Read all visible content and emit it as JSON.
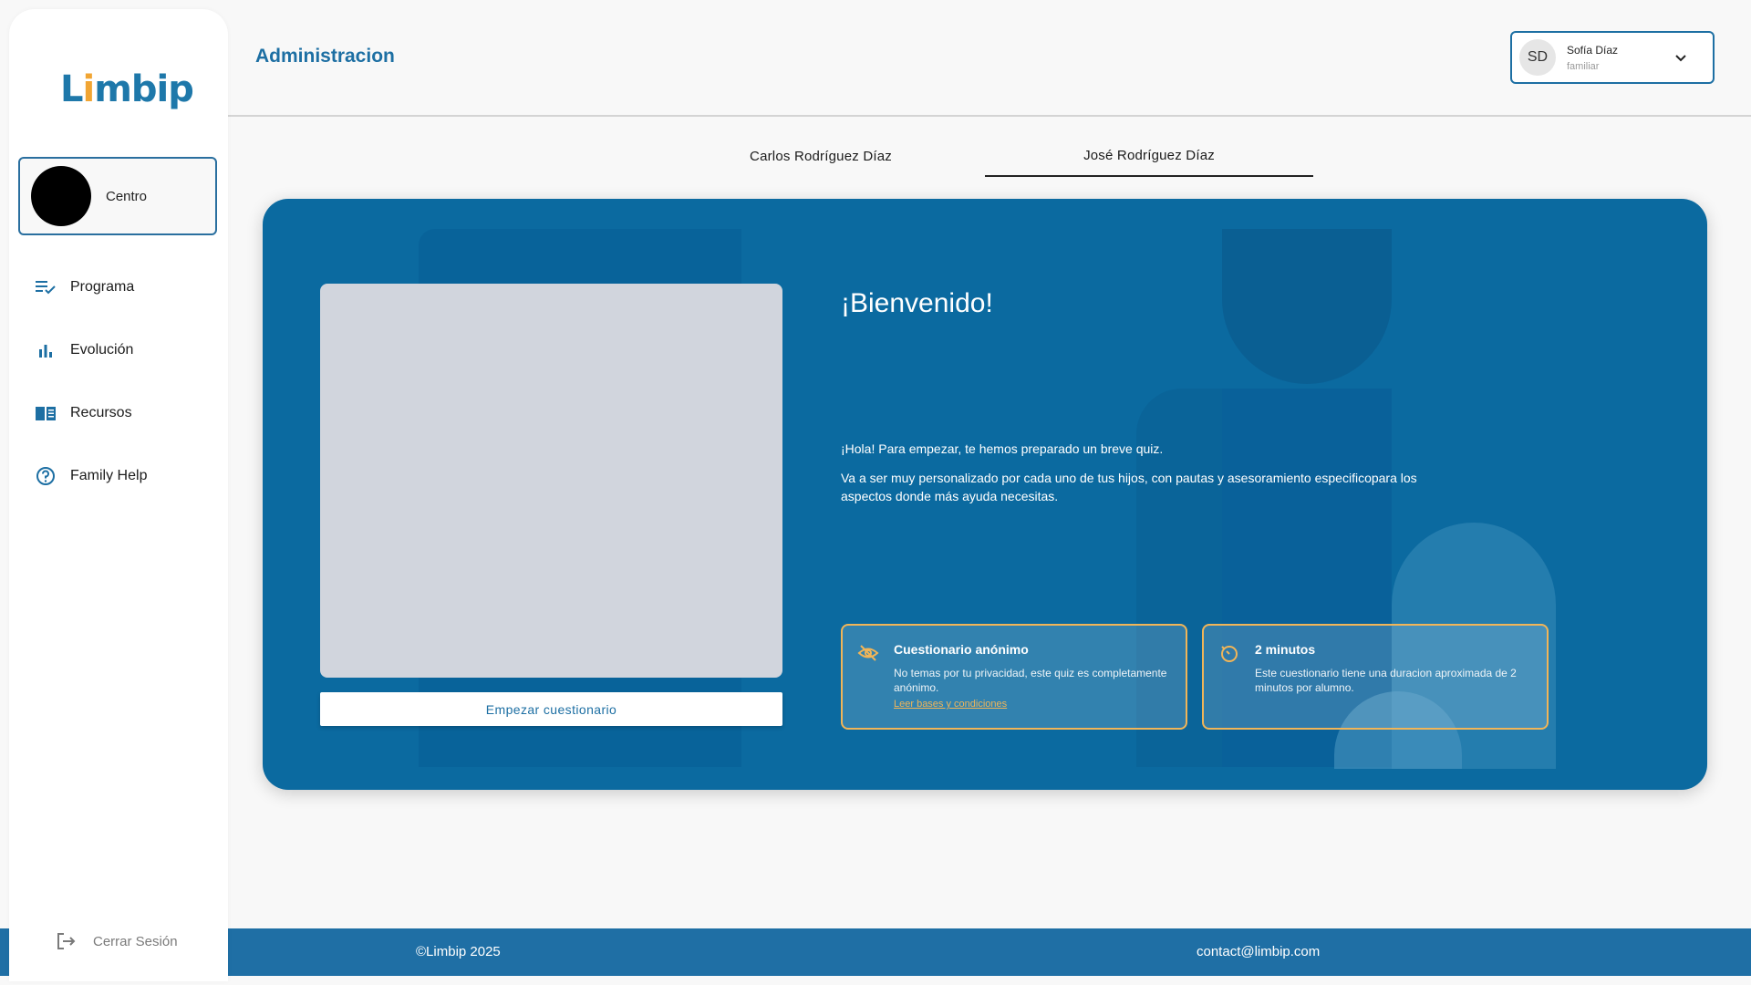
{
  "sidebar": {
    "logo": {
      "text_start": "L",
      "text_dot": "i",
      "text_end": "mbip"
    },
    "center": {
      "label": "Centro"
    },
    "items": [
      {
        "label": "Programa",
        "icon": "checklist-icon"
      },
      {
        "label": "Evolución",
        "icon": "bar-chart-icon"
      },
      {
        "label": "Recursos",
        "icon": "book-icon"
      },
      {
        "label": "Family Help",
        "icon": "help-circle-icon"
      }
    ],
    "logout_label": "Cerrar Sesión"
  },
  "header": {
    "title": "Administracion",
    "user": {
      "initials": "SD",
      "name": "Sofía Díaz",
      "role": "familiar"
    }
  },
  "tabs": [
    {
      "label": "Carlos Rodríguez Díaz",
      "active": false
    },
    {
      "label": "José Rodríguez Díaz",
      "active": true
    }
  ],
  "main": {
    "welcome": "¡Bienvenido!",
    "intro_1": "¡Hola! Para empezar, te hemos preparado un breve quiz.",
    "intro_2": "Va a ser muy personalizado por cada uno de tus hijos, con pautas y asesoramiento especificopara los aspectos donde más ayuda necesitas.",
    "start_button": "Empezar cuestionario",
    "info": [
      {
        "title": "Cuestionario anónimo",
        "desc": "No temas por tu privacidad, este quiz es completamente anónimo.",
        "link": "Leer bases y condiciones",
        "icon": "eye-off-icon"
      },
      {
        "title": "2 minutos",
        "desc": "Este cuestionario tiene una duracion aproximada de 2 minutos por alumno.",
        "icon": "timer-icon"
      }
    ]
  },
  "footer": {
    "copyright": "©Limbip 2025",
    "contact": "contact@limbip.com"
  },
  "colors": {
    "primary": "#1d6fa3",
    "card": "#0b6aa0",
    "accent": "#f1b558"
  }
}
